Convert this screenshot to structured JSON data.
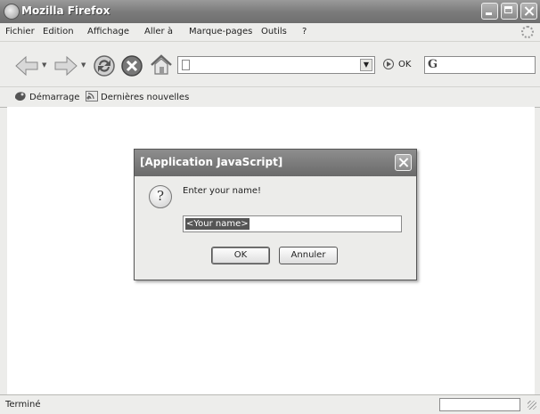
{
  "window": {
    "title": "Mozilla Firefox"
  },
  "menu": {
    "items": [
      "Fichier",
      "Edition",
      "Affichage",
      "Aller à",
      "Marque-pages",
      "Outils",
      "?"
    ]
  },
  "toolbar": {
    "url_value": "",
    "go_label": "OK",
    "search_value": ""
  },
  "bookmarks": [
    "Démarrage",
    "Dernières nouvelles"
  ],
  "dialog": {
    "title": "[Application JavaScript]",
    "message": "Enter your name!",
    "input_value": "<Your name>",
    "ok_label": "OK",
    "cancel_label": "Annuler"
  },
  "status": {
    "text": "Terminé"
  }
}
